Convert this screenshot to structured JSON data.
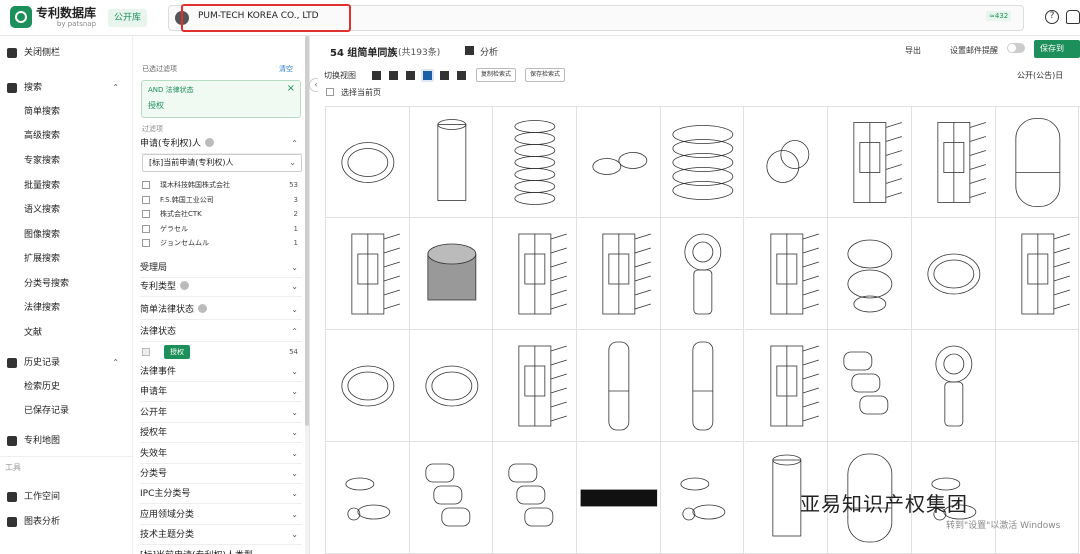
{
  "app": {
    "title": "专利数据库",
    "subtitle": "by patsnap",
    "db_badge": "公开库"
  },
  "search": {
    "query": "PUM-TECH KOREA CO., LTD",
    "count_badge": "≈432"
  },
  "sidebar": {
    "items": [
      {
        "label": "关闭侧栏",
        "icon": "collapse-icon",
        "type": "top"
      },
      {
        "label": "搜索",
        "icon": "search-icon",
        "type": "group",
        "expanded": true
      },
      {
        "label": "简单搜索",
        "type": "sub"
      },
      {
        "label": "高级搜索",
        "type": "sub"
      },
      {
        "label": "专家搜索",
        "type": "sub"
      },
      {
        "label": "批量搜索",
        "type": "sub"
      },
      {
        "label": "语义搜索",
        "type": "sub"
      },
      {
        "label": "图像搜索",
        "type": "sub"
      },
      {
        "label": "扩展搜索",
        "type": "sub"
      },
      {
        "label": "分类号搜索",
        "type": "sub"
      },
      {
        "label": "法律搜索",
        "type": "sub"
      },
      {
        "label": "文献",
        "type": "sub"
      },
      {
        "label": "历史记录",
        "icon": "clock-icon",
        "type": "group",
        "expanded": true
      },
      {
        "label": "检索历史",
        "type": "sub"
      },
      {
        "label": "已保存记录",
        "type": "sub"
      },
      {
        "label": "专利地图",
        "icon": "map-icon",
        "type": "top"
      }
    ],
    "tools_label": "工具",
    "tools": [
      {
        "label": "工作空间",
        "icon": "workspace-icon"
      },
      {
        "label": "图表分析",
        "icon": "chart-icon"
      }
    ]
  },
  "filters": {
    "selected_title": "已选过滤项",
    "clear": "清空",
    "chip_line1": "AND  法律状态",
    "chip_line2": "授权",
    "hint": "过滤项",
    "applicant_section": "申请(专利权)人",
    "applicant_select": "[标]当前申请(专利权)人",
    "applicants": [
      {
        "name": "璞木科技韩国株式会社",
        "count": "53"
      },
      {
        "name": "F.S.韩国工业公司",
        "count": "3"
      },
      {
        "name": "株式会社CTK",
        "count": "2"
      },
      {
        "name": "ゲラセル",
        "count": "1"
      },
      {
        "name": "ジョンセムムル",
        "count": "1"
      }
    ],
    "sections_a": [
      "受理局",
      "专利类型",
      "简单法律状态",
      "法律状态"
    ],
    "grant_label": "授权",
    "grant_count": "54",
    "sections_b": [
      "法律事件",
      "申请年",
      "公开年",
      "授权年",
      "失效年",
      "分类号",
      "IPC主分类号",
      "应用领域分类",
      "技术主题分类",
      "[标]当前申请(专利权)人类型"
    ]
  },
  "results": {
    "title": "54 组简单同族",
    "total": "(共193条)",
    "analysis": "分析",
    "export": "导出",
    "mail_alert": "设置邮件提醒",
    "save": "保存到",
    "view_label": "切换视图",
    "copy_expr": "复制检索式",
    "save_expr": "保存检索式",
    "sort": "公开(公告)日",
    "select_page": "选择当前页"
  },
  "overlay": {
    "watermark": "亚易知识产权集团",
    "activate": "转到\"设置\"以激活 Windows"
  },
  "colors": {
    "brand": "#1c8f5a",
    "highlight": "#e03030"
  }
}
